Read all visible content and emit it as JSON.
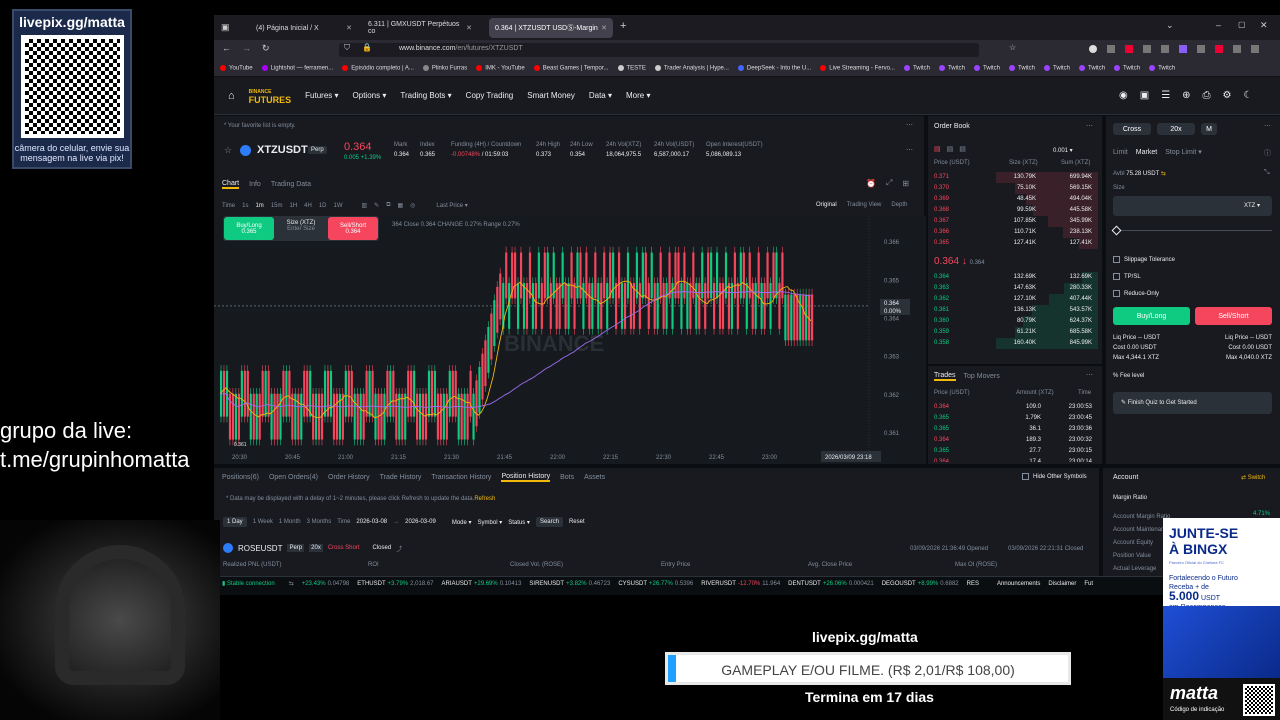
{
  "stream": {
    "qr_title": "livepix.gg/matta",
    "qr_caption": "câmera do celular, envie sua mensagem na live via pix!",
    "group_line1": "grupo da live:",
    "group_line2": "t.me/grupinhomatta",
    "livepix": "livepix.gg/matta",
    "goal": "GAMEPLAY E/OU FILME. (R$ 2,01/R$ 108,00)",
    "goal_progress": 0.019,
    "ends": "Termina em 17 dias",
    "promo_title": "JUNTE-SE À BINGX",
    "promo_small": "Parceiro Oficial do Chelsea FC",
    "promo_line1": "Fortalecendo o Futuro",
    "promo_line2": "Receba + de",
    "promo_amount": "5.000",
    "promo_unit": "USDT",
    "promo_line3": "em Recompensas",
    "promo_brand": "matta",
    "promo_code": "Código de indicação"
  },
  "browser": {
    "tabs": [
      "(4) Página Inicial / X",
      "6.311 | GMXUSDT Perpétuos co",
      "0.364 | XTZUSDT USDⓈ-Margin"
    ],
    "url_host": "www.binance.com",
    "url_path": "/en/futures/XTZUSDT",
    "bookmarks": [
      "YouTube",
      "Lightshot — ferramen...",
      "Episódio completo | A...",
      "Plinko Furras",
      "IMK - YouTube",
      "Beast Games | Tempor...",
      "TESTE",
      "Trader Analysis | Hype...",
      "DeepSeek - Into the U...",
      "Live Streaming - Fervo...",
      "Twitch",
      "Twitch",
      "Twitch",
      "Twitch",
      "Twitch",
      "Twitch",
      "Twitch",
      "Twitch"
    ]
  },
  "nav": {
    "logo_top": "BINANCE",
    "logo_bottom": "FUTURES",
    "items": [
      "Futures",
      "Options",
      "Trading Bots",
      "Copy Trading",
      "Smart Money",
      "Data",
      "More"
    ]
  },
  "ticker": {
    "favorites": "* Your favorite list is empty.",
    "symbol": "XTZUSDT",
    "type": "Perp",
    "price": "0.364",
    "change": "0.005 +1.39%",
    "stats": [
      {
        "label": "Mark",
        "value": "0.364"
      },
      {
        "label": "Index",
        "value": "0.365"
      },
      {
        "label": "Funding (4H) / Countdown",
        "value": "-0.00748%",
        "extra": "/ 01:59:03"
      },
      {
        "label": "24h High",
        "value": "0.373"
      },
      {
        "label": "24h Low",
        "value": "0.354"
      },
      {
        "label": "24h Vol(XTZ)",
        "value": "18,064,975.5"
      },
      {
        "label": "24h Vol(USDT)",
        "value": "6,587,000.17"
      },
      {
        "label": "Open Interest(USDT)",
        "value": "5,086,089.13"
      }
    ]
  },
  "chart": {
    "tabs": [
      "Chart",
      "Info",
      "Trading Data"
    ],
    "intervals": [
      "Time",
      "1s",
      "1m",
      "15m",
      "1H",
      "4H",
      "1D",
      "1W"
    ],
    "last_price": "Last Price",
    "views": [
      "Original",
      "Trading View",
      "Depth"
    ],
    "buy_label": "Buy/Long",
    "buy_price": "0.365",
    "size_label": "Size (XTZ)",
    "size_placeholder": "Enter Size",
    "sell_label": "Sell/Short",
    "sell_price": "0.364",
    "ohlc": "364  Close  0.364  CHANGE  0.27%  Range  0.27%",
    "watermark": "BINANCE",
    "price_axis": [
      "0.366",
      "0.365",
      "0.364",
      "0.363",
      "0.362",
      "0.361"
    ],
    "current_price": "0.364",
    "current_pct": "0.00%",
    "time_axis": [
      "20:30",
      "20:45",
      "21:00",
      "21:15",
      "21:30",
      "21:45",
      "22:00",
      "22:15",
      "22:30",
      "22:45",
      "23:00"
    ],
    "time_cursor": "2026/03/09 23:18",
    "low_label": "0.361"
  },
  "orderbook": {
    "title": "Order Book",
    "precision": "0.001",
    "headers": [
      "Price (USDT)",
      "Size (XTZ)",
      "Sum (XTZ)"
    ],
    "asks": [
      [
        "0.371",
        "130.79K",
        "699.94K"
      ],
      [
        "0.370",
        "75.10K",
        "569.15K"
      ],
      [
        "0.369",
        "48.45K",
        "494.04K"
      ],
      [
        "0.368",
        "99.59K",
        "445.58K"
      ],
      [
        "0.367",
        "107.85K",
        "345.99K"
      ],
      [
        "0.366",
        "110.71K",
        "238.13K"
      ],
      [
        "0.365",
        "127.41K",
        "127.41K"
      ]
    ],
    "mid_price": "0.364",
    "mid_mark": "0.364",
    "bids": [
      [
        "0.364",
        "132.69K",
        "132.69K"
      ],
      [
        "0.363",
        "147.63K",
        "280.33K"
      ],
      [
        "0.362",
        "127.10K",
        "407.44K"
      ],
      [
        "0.361",
        "136.13K",
        "543.57K"
      ],
      [
        "0.360",
        "80.79K",
        "624.37K"
      ],
      [
        "0.359",
        "61.21K",
        "685.58K"
      ],
      [
        "0.358",
        "160.40K",
        "845.99K"
      ]
    ]
  },
  "trades": {
    "tabs": [
      "Trades",
      "Top Movers"
    ],
    "headers": [
      "Price (USDT)",
      "Amount (XTZ)",
      "Time"
    ],
    "rows": [
      [
        "0.364",
        "109.0",
        "23:00:53",
        "r"
      ],
      [
        "0.365",
        "1.79K",
        "23:00:45",
        "g"
      ],
      [
        "0.365",
        "36.1",
        "23:00:36",
        "g"
      ],
      [
        "0.364",
        "189.3",
        "23:00:32",
        "r"
      ],
      [
        "0.365",
        "27.7",
        "23:00:15",
        "g"
      ],
      [
        "0.364",
        "17.4",
        "23:00:14",
        "r"
      ]
    ]
  },
  "order_form": {
    "margin_mode": "Cross",
    "leverage": "20x",
    "mode": "M",
    "types": [
      "Limit",
      "Market",
      "Stop Limit"
    ],
    "avbl_label": "Avbl",
    "avbl": "75.28 USDT",
    "size_label": "Size",
    "size_unit": "XTZ",
    "options": [
      "Slippage Tolerance",
      "TP/SL",
      "Reduce-Only"
    ],
    "buy": "Buy/Long",
    "sell": "Sell/Short",
    "liq_left": "Liq Price -- USDT",
    "cost_left": "Cost 0.00 USDT",
    "max_left": "Max 4,344.1 XTZ",
    "liq_right": "Liq Price -- USDT",
    "cost_right": "Cost 0.00 USDT",
    "max_right": "Max 4,040.0 XTZ",
    "fee": "Fee level",
    "quiz": "Finish Quiz to Get Started"
  },
  "positions": {
    "tabs": [
      "Positions(6)",
      "Open Orders(4)",
      "Order History",
      "Trade History",
      "Transaction History",
      "Position History",
      "Bots",
      "Assets"
    ],
    "hide_other": "Hide Other Symbols",
    "notice": "* Data may be displayed with a delay of 1~2 minutes, please click Refresh to update the data.",
    "refresh": "Refresh",
    "ranges": [
      "1 Day",
      "1 Week",
      "1 Month",
      "3 Months"
    ],
    "time_label": "Time",
    "date_from": "2026-03-08",
    "date_to": "2026-03-09",
    "filters": [
      "Mode",
      "Symbol",
      "Status"
    ],
    "search": "Search",
    "reset": "Reset",
    "row_symbol": "ROSEUSDT",
    "row_type": "Perp",
    "row_lev": "20x",
    "row_mode": "Cross Short",
    "row_status": "Closed",
    "row_opened": "03/09/2026 21:36:49 Opened",
    "row_closed": "03/09/2026 22:21:31 Closed",
    "cols": [
      "Realized PNL (USDT)",
      "ROI",
      "Closed Vol. (ROSE)",
      "Entry Price",
      "Avg. Close Price",
      "Max OI (ROSE)"
    ]
  },
  "account": {
    "title": "Account",
    "switch": "Switch",
    "margin_ratio": "Margin Ratio",
    "rows": [
      "Account Margin Ratio",
      "Account Maintenance",
      "Account Equity",
      "Position Value",
      "Actual Leverage"
    ],
    "ratio": "4.71%"
  },
  "statusbar": {
    "connection": "Stable connection",
    "tickers": [
      [
        "",
        "+23.43%",
        "0.04798",
        "g"
      ],
      [
        "ETHUSDT",
        "+3.79%",
        "2,018.67",
        "g"
      ],
      [
        "ARIAUSDT",
        "+29.69%",
        "0.10413",
        "g"
      ],
      [
        "SIRENUSDT",
        "+3.82%",
        "0.46723",
        "g"
      ],
      [
        "CYSUSDT",
        "+26.77%",
        "0.5396",
        "g"
      ],
      [
        "RIVERUSDT",
        "-12.70%",
        "11.964",
        "r"
      ],
      [
        "DENTUSDT",
        "+26.06%",
        "0.000421",
        "g"
      ],
      [
        "DEGOUSDT",
        "+8.99%",
        "0.6882",
        "g"
      ],
      [
        "RES",
        "",
        "",
        ""
      ]
    ],
    "links": [
      "Announcements",
      "Disclaimer",
      "Fut"
    ]
  }
}
